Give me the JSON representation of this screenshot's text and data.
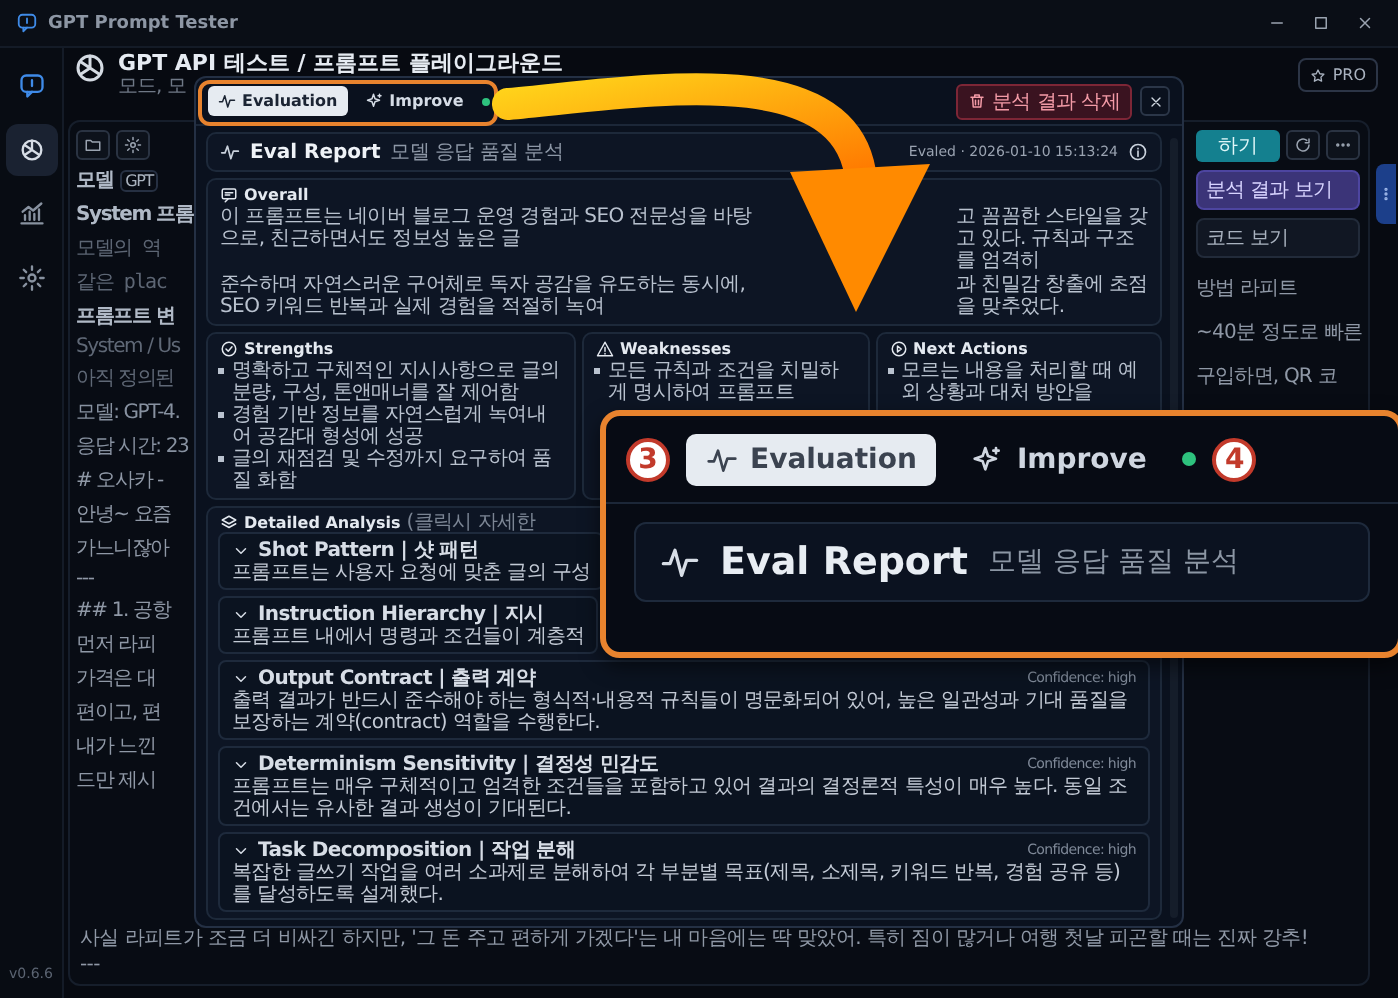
{
  "window": {
    "title": "GPT Prompt Tester",
    "version": "v0.6.6"
  },
  "rail": [
    {
      "kind": "chat",
      "selected": false
    },
    {
      "kind": "knot",
      "selected": true
    },
    {
      "kind": "chart",
      "selected": false
    },
    {
      "kind": "gear",
      "selected": false
    }
  ],
  "header": {
    "title": "GPT API 테스트 / 프롬프트 플레이그라운드",
    "subtitle": "모드, 모",
    "pro_button": "PRO"
  },
  "left_strip": [
    {
      "kind": "pair",
      "label": "모델",
      "value": "GPT"
    },
    {
      "kind": "label",
      "text": "System 프롬"
    },
    {
      "kind": "code",
      "text": "모델의 역"
    },
    {
      "kind": "code",
      "text": "같은 plac"
    },
    {
      "kind": "label",
      "text": "프롬프트 변"
    },
    {
      "kind": "muted",
      "text": "System / Us"
    },
    {
      "kind": "muted",
      "text": "아직 정의된"
    },
    {
      "kind": "meta",
      "text": "모델: GPT-4."
    },
    {
      "kind": "meta",
      "text": "응답 시간: 23"
    },
    {
      "kind": "doc",
      "text": "# 오사카 -"
    },
    {
      "kind": "doc",
      "text": "안녕~ 요즘"
    },
    {
      "kind": "doc",
      "text": "가느니잖아"
    },
    {
      "kind": "doc",
      "text": "---"
    },
    {
      "kind": "doc",
      "text": "## 1. 공항"
    },
    {
      "kind": "doc",
      "text": "먼저 라피"
    },
    {
      "kind": "doc",
      "text": "가격은 대"
    },
    {
      "kind": "doc",
      "text": "편이고, 편"
    },
    {
      "kind": "doc",
      "text": "내가 느낀"
    },
    {
      "kind": "doc",
      "text": "드만 제시"
    }
  ],
  "right_strip": {
    "buttons": [
      {
        "kind": "primary",
        "label": "하기"
      },
      {
        "kind": "refresh"
      },
      {
        "kind": "more"
      }
    ],
    "menu": [
      {
        "label": "분석 결과 보기",
        "selected": true
      },
      {
        "label": "코드 보기",
        "selected": false
      }
    ],
    "doc": [
      "방법 라피트",
      "~40분 정도로 빠른",
      "구입하면, QR 코"
    ]
  },
  "bottom_lines": [
    "사실 라피트가 조금 더 비싸긴 하지만, '그 돈 주고 편하게 가겠다'는 내 마음에는 딱 맞았어. 특히 짐이 많거나 여행 첫날 피곤할 때는 진짜 강추!",
    "---"
  ],
  "modal": {
    "tabs": [
      {
        "label": "Evaluation",
        "kind": "pulse",
        "selected": true,
        "indicator": false
      },
      {
        "label": "Improve",
        "kind": "sparkle",
        "selected": false,
        "indicator": true
      }
    ],
    "delete_button": "분석 결과 삭제",
    "report": {
      "title": "Eval Report",
      "subtitle": "모델 응답 품질 분석",
      "evaled": "Evaled · 2026-01-10 15:13:24"
    },
    "overall": {
      "title": "Overall",
      "segments": [
        "이 프롬프트는 네이버 블로그 운영 경험과 SEO 전문성을 바탕으로, 친근하면서도 정보성 높은 글",
        "고 꼼꼼한 스타일을 갖고 있다. 규칙과 구조를 엄격히",
        "준수하며 자연스러운 구어체로 독자 공감을 유도하는 동시에, SEO 키워드 반복과 실제 경험을 적절히 녹여",
        "과 친밀감 창출에 초점을 맞추었다."
      ]
    },
    "sections": [
      {
        "kind": "strengths",
        "title": "Strengths",
        "items": [
          "명확하고 구체적인 지시사항으로 글의 분량, 구성, 톤앤매너를 잘 제어함",
          "경험 기반 정보를 자연스럽게 녹여내어 공감대 형성에 성공",
          "글의 재점검 및 수정까지 요구하여 품질 화함"
        ]
      },
      {
        "kind": "weaknesses",
        "title": "Weaknesses",
        "items": [
          "모든 규칙과 조건을 치밀하게 명시하여 프롬프트"
        ]
      },
      {
        "kind": "next",
        "title": "Next Actions",
        "items": [
          "모르는 내용을 처리할 때 예외 상황과 대처 방안을"
        ]
      }
    ],
    "detailed": {
      "title": "Detailed Analysis",
      "note": "(클릭시 자세한",
      "items": [
        {
          "title": "Shot Pattern | 샷 패턴",
          "text": "프롬프트는 사용자 요청에 맞춘 글의 구성",
          "expanded": true
        },
        {
          "title": "Instruction Hierarchy | 지시",
          "text": "프롬프트 내에서 명령과 조건들이 계층적",
          "expanded": true
        },
        {
          "title": "Output Contract | 출력 계약",
          "confidence": "Confidence: high",
          "text": "출력 결과가 반드시 준수해야 하는 형식적·내용적 규칙들이 명문화되어 있어, 높은 일관성과 기대 품질을 보장하는 계약(contract) 역할을 수행한다.",
          "expanded": true
        },
        {
          "title": "Determinism Sensitivity | 결정성 민감도",
          "confidence": "Confidence: high",
          "text": "프롬프트는 매우 구체적이고 엄격한 조건들을 포함하고 있어 결과의 결정론적 특성이 매우 높다. 동일 조건에서는 유사한 결과 생성이 기대된다.",
          "expanded": true
        },
        {
          "title": "Task Decomposition | 작업 분해",
          "confidence": "Confidence: high",
          "text": "복잡한 글쓰기 작업을 여러 소과제로 분해하여 각 부분별 목표(제목, 소제목, 키워드 반복, 경험 공유 등)를 달성하도록 설계했다.",
          "expanded": true
        }
      ]
    }
  },
  "zoom_inset": {
    "badges": [
      "3",
      "4"
    ],
    "tabs": [
      {
        "label": "Evaluation",
        "kind": "pulse",
        "selected": true,
        "indicator": false
      },
      {
        "label": "Improve",
        "kind": "sparkle",
        "selected": false,
        "indicator": true
      }
    ],
    "title": "Eval Report",
    "subtitle": "모델 응답 품질 분석"
  }
}
